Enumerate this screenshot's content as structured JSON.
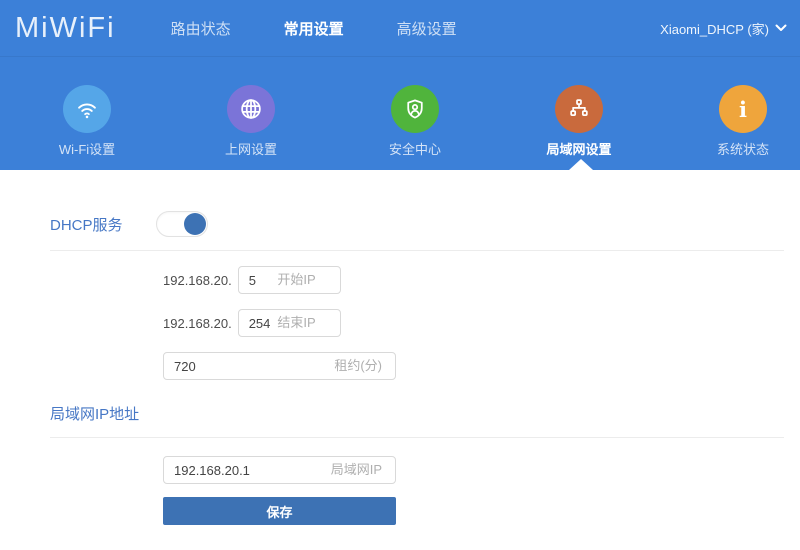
{
  "header": {
    "logo": "MiWiFi",
    "nav": [
      {
        "label": "路由状态",
        "active": false
      },
      {
        "label": "常用设置",
        "active": true
      },
      {
        "label": "高级设置",
        "active": false
      }
    ],
    "account_label": "Xiaomi_DHCP (家)",
    "account_icon": "chevron-down-icon"
  },
  "tabs": {
    "items": [
      {
        "label": "Wi-Fi设置",
        "icon": "wifi-icon",
        "color": "#55A6E8",
        "active": false
      },
      {
        "label": "上网设置",
        "icon": "globe-icon",
        "color": "#7B74D8",
        "active": false
      },
      {
        "label": "安全中心",
        "icon": "shield-icon",
        "color": "#50B43C",
        "active": false
      },
      {
        "label": "局域网设置",
        "icon": "lan-icon",
        "color": "#C96A3D",
        "active": true
      },
      {
        "label": "系统状态",
        "icon": "info-icon",
        "color": "#EFA53C",
        "active": false
      }
    ]
  },
  "dhcp": {
    "section_title": "DHCP服务",
    "toggle_on": true,
    "rows": [
      {
        "prefix": "192.168.20.",
        "value": "5",
        "label": "开始IP"
      },
      {
        "prefix": "192.168.20.",
        "value": "254",
        "label": "结束IP"
      },
      {
        "value": "720",
        "label": "租约(分)"
      }
    ]
  },
  "lan": {
    "section_title": "局域网IP地址",
    "ip": {
      "value": "192.168.20.1",
      "label": "局域网IP"
    },
    "save_label": "保存"
  },
  "colors": {
    "topbar_blue": "#3C80D8",
    "accent_button_blue": "#3D72B4",
    "section_title_blue": "#4677C5",
    "input_border": "#D9D9D9",
    "divider": "#ECECEC"
  }
}
